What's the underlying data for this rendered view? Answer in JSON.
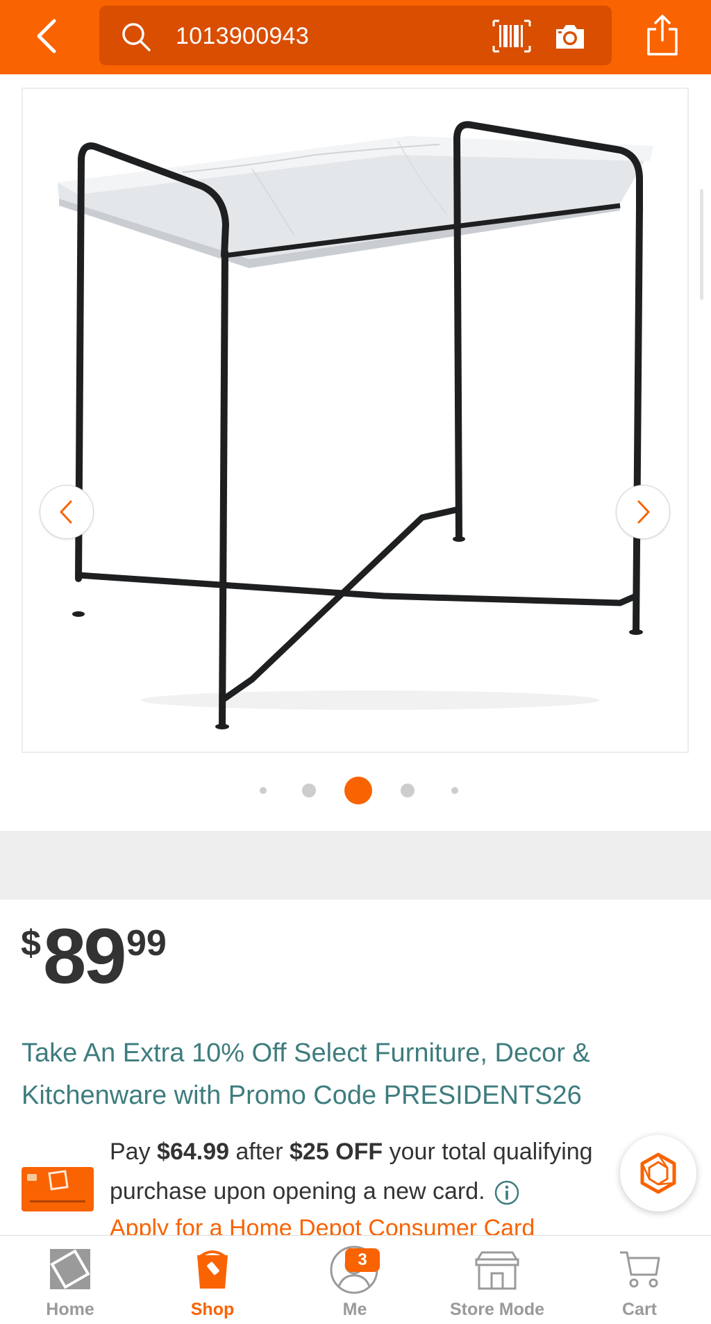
{
  "header": {
    "search_value": "1013900943",
    "colors": {
      "brand": "#F96302",
      "search_bg": "#D94E00"
    }
  },
  "gallery": {
    "image_icon": "marble-top-side-table",
    "dot_count": 5,
    "active_dot_index": 2
  },
  "price": {
    "currency_symbol": "$",
    "dollars": "89",
    "cents": "99"
  },
  "promo": {
    "text": "Take An Extra 10% Off Select Furniture, Decor & Kitchenware with Promo Code PRESIDENTS26"
  },
  "offer": {
    "pay": "Pay",
    "amount": "$64.99",
    "after": "after",
    "discount": "$25 OFF",
    "rest": "your total qualifying purchase upon opening a new card.",
    "apply_link": "Apply for a Home Depot Consumer Card"
  },
  "bottom_nav": {
    "items": [
      {
        "label": "Home",
        "icon": "home-depot-logo-icon"
      },
      {
        "label": "Shop",
        "icon": "bucket-icon",
        "active": true
      },
      {
        "label": "Me",
        "icon": "user-icon",
        "badge": "3"
      },
      {
        "label": "Store Mode",
        "icon": "store-icon"
      },
      {
        "label": "Cart",
        "icon": "cart-icon"
      }
    ]
  }
}
